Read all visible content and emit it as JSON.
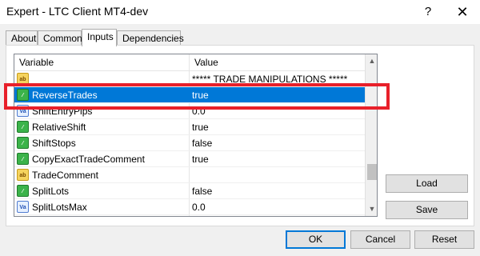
{
  "window": {
    "title": "Expert - LTC Client MT4-dev",
    "help_label": "?",
    "close_label": "✕"
  },
  "tabs": [
    {
      "label": "About",
      "active": false
    },
    {
      "label": "Common",
      "active": false
    },
    {
      "label": "Inputs",
      "active": true
    },
    {
      "label": "Dependencies",
      "active": false
    }
  ],
  "grid": {
    "headers": {
      "variable": "Variable",
      "value": "Value"
    },
    "rows": [
      {
        "icon": "ab",
        "variable": "",
        "value": "***** TRADE MANIPULATIONS *****"
      },
      {
        "icon": "bool",
        "variable": "ReverseTrades",
        "value": "true",
        "selected": true
      },
      {
        "icon": "va",
        "variable": "ShiftEntryPips",
        "value": "0.0"
      },
      {
        "icon": "bool",
        "variable": "RelativeShift",
        "value": "true"
      },
      {
        "icon": "bool",
        "variable": "ShiftStops",
        "value": "false"
      },
      {
        "icon": "bool",
        "variable": "CopyExactTradeComment",
        "value": "true"
      },
      {
        "icon": "ab",
        "variable": "TradeComment",
        "value": ""
      },
      {
        "icon": "bool",
        "variable": "SplitLots",
        "value": "false"
      },
      {
        "icon": "va",
        "variable": "SplitLotsMax",
        "value": "0.0"
      }
    ]
  },
  "icon_labels": {
    "ab": "ab",
    "va": "Va",
    "bool": "⁄"
  },
  "side_buttons": {
    "load": "Load",
    "save": "Save"
  },
  "bottom_buttons": {
    "ok": "OK",
    "cancel": "Cancel",
    "reset": "Reset"
  },
  "colors": {
    "selection": "#0078d7",
    "highlight_box": "#e8202a"
  }
}
